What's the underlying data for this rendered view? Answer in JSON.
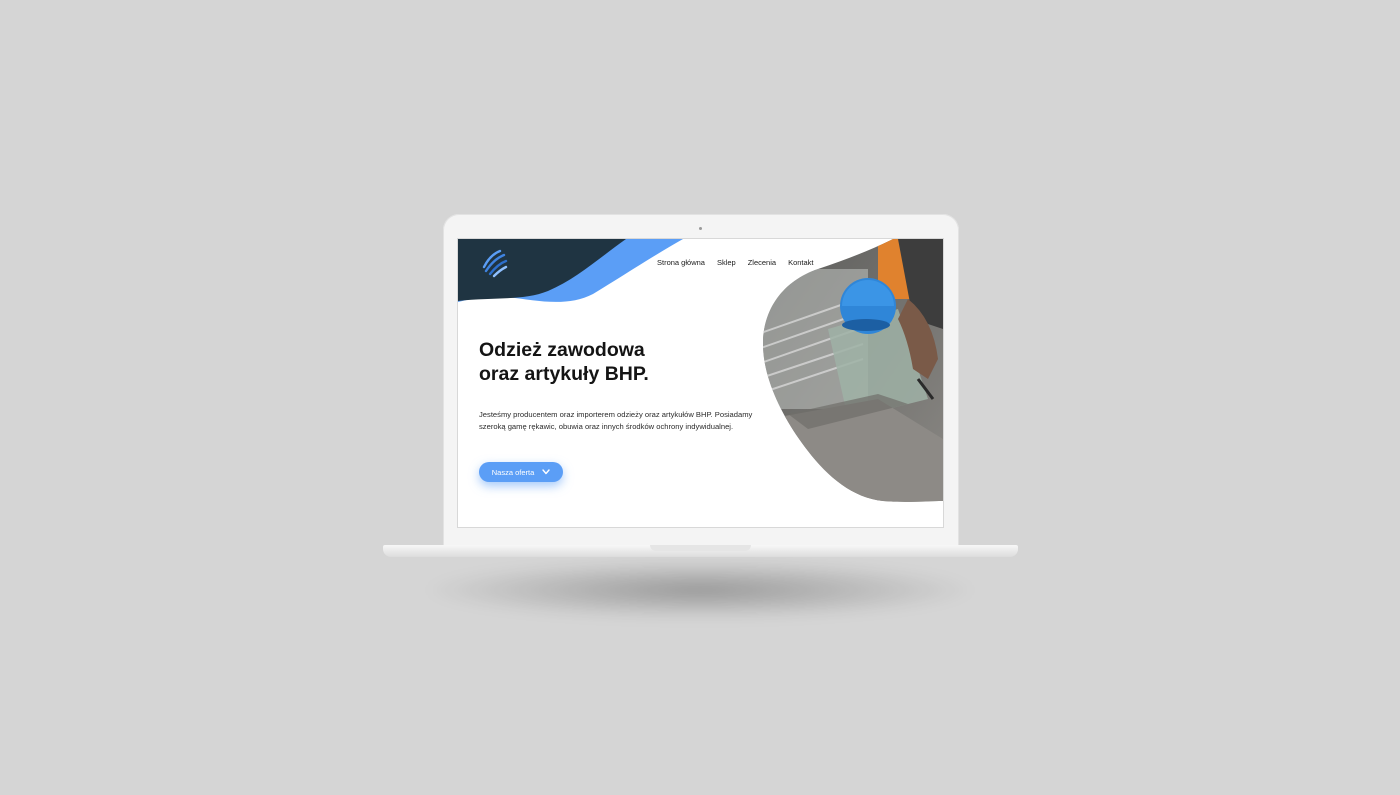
{
  "nav": {
    "items": [
      {
        "label": "Strona główna"
      },
      {
        "label": "Sklep"
      },
      {
        "label": "Zlecenia"
      },
      {
        "label": "Kontakt"
      }
    ]
  },
  "hero": {
    "title_line1": "Odzież zawodowa",
    "title_line2": "oraz artykuły BHP.",
    "description": "Jesteśmy producentem oraz importerem odzieży oraz artykułów BHP. Posiadamy szeroką gamę rękawic, obuwia oraz innych środków ochrony indywidualnej.",
    "cta_label": "Nasza oferta",
    "cta_icon": "chevron-down-icon",
    "image": "construction-worker-photo"
  },
  "logo": "company-logo",
  "colors": {
    "dark_navy": "#1f3442",
    "accent_blue": "#5b9ef6",
    "background": "#d5d5d5"
  }
}
